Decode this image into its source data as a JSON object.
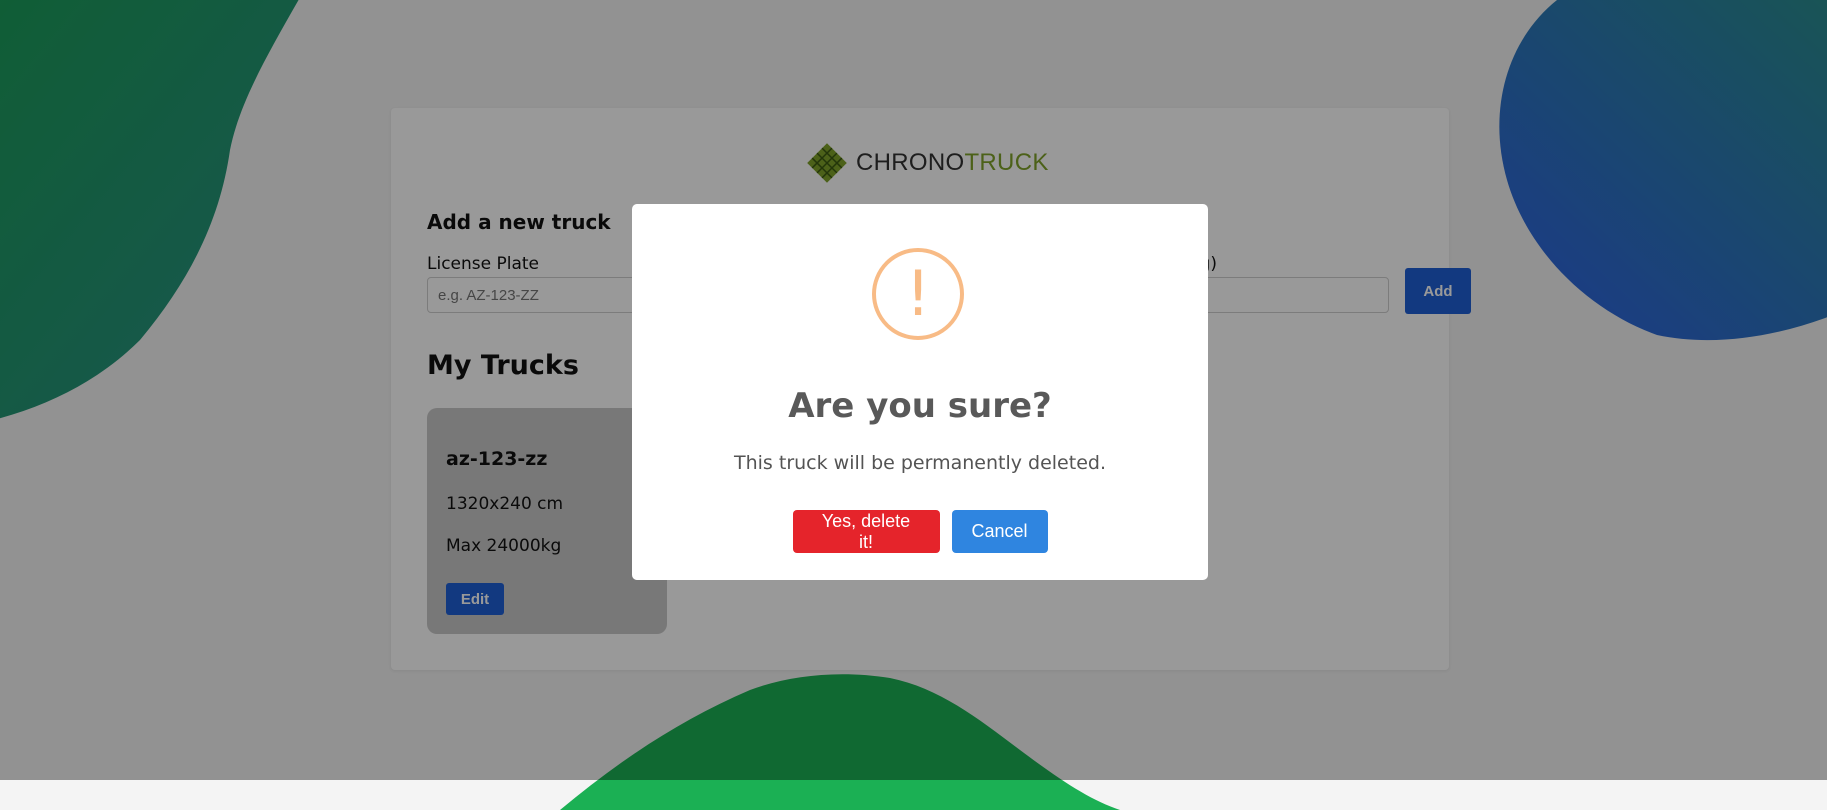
{
  "colors": {
    "accent": "#1f5fd6",
    "logo_green": "#7fa22a",
    "warning": "#f8bb86",
    "danger": "#e5242b",
    "cancel": "#2f85e0"
  },
  "logo": {
    "icon": "chronotruck-logo-icon",
    "text_part1": "CHRONO",
    "text_part2": "TRUCK"
  },
  "add_truck": {
    "title": "Add a new truck",
    "license_plate_label": "License Plate",
    "license_plate_placeholder": "e.g. AZ-123-ZZ",
    "weight_label_visible": "t (kg)",
    "weight_value": "",
    "add_button": "Add"
  },
  "my_trucks": {
    "title": "My Trucks",
    "trucks": [
      {
        "plate": "az-123-zz",
        "dimensions": "1320x240 cm",
        "max_weight": "Max 24000kg",
        "edit_button": "Edit"
      }
    ]
  },
  "dialog": {
    "icon": "warning-icon",
    "icon_glyph": "!",
    "title": "Are you sure?",
    "text": "This truck will be permanently deleted.",
    "confirm_button": "Yes, delete it!",
    "cancel_button": "Cancel"
  }
}
